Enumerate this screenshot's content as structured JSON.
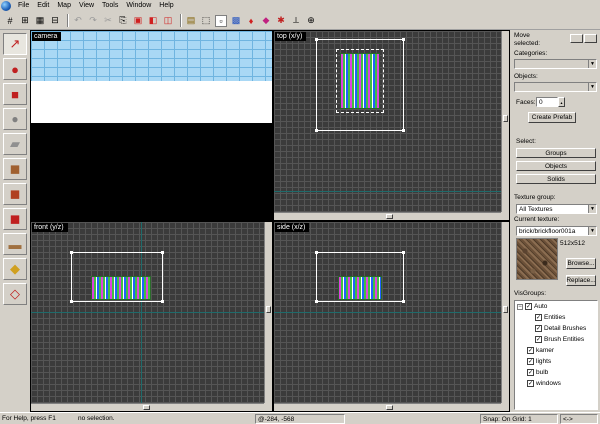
{
  "menu": [
    "File",
    "Edit",
    "Map",
    "View",
    "Tools",
    "Window",
    "Help"
  ],
  "toolbar_icons": [
    "grid-icon",
    "grid-smaller-icon",
    "grid-larger-icon",
    "texture-lock-icon",
    "undo-icon",
    "redo-icon",
    "carve-icon",
    "group-icon",
    "ungroup-icon",
    "hide-icon",
    "show-icon",
    "selection-box-icon",
    "select-handles-icon",
    "texture-app-icon",
    "run-map-icon",
    "entity-report-icon",
    "check-problems-icon",
    "cordon-icon",
    "decal-icon"
  ],
  "tools": [
    "pointer-icon",
    "magnify-icon",
    "camera-icon",
    "entity-icon",
    "block-icon",
    "texture-application-icon",
    "apply-texture-icon",
    "decal-icon",
    "overlay-icon",
    "clip-icon",
    "vertex-icon"
  ],
  "viewports": {
    "camera": "camera",
    "top": "top (x/y)",
    "front": "front (y/z)",
    "side": "side (x/z)"
  },
  "panel": {
    "move_selected": "Move selected:",
    "categories": "Categories:",
    "objects": "Objects:",
    "faces": "Faces:",
    "faces_value": "0",
    "create_prefab": "Create Prefab",
    "select": "Select:",
    "groups": "Groups",
    "objects_btn": "Objects",
    "solids": "Solids",
    "texture_group": "Texture group:",
    "texture_group_value": "All Textures",
    "current_texture": "Current texture:",
    "current_texture_value": "brick/brickfloor001a",
    "texture_size": "512x512",
    "browse": "Browse...",
    "replace": "Replace...",
    "visgroups": "VisGroups:",
    "visgroup_items": [
      {
        "label": "Auto",
        "level": 0,
        "expand": "−"
      },
      {
        "label": "Entities",
        "level": 1
      },
      {
        "label": "Detail Brushes",
        "level": 1
      },
      {
        "label": "Brush Entities",
        "level": 1
      },
      {
        "label": "kamer",
        "level": 0
      },
      {
        "label": "lights",
        "level": 0
      },
      {
        "label": "bulb",
        "level": 0
      },
      {
        "label": "windows",
        "level": 0
      }
    ]
  },
  "status": {
    "help": "For Help, press F1",
    "selection": "no selection.",
    "coords": "@-284, -568",
    "snap": "Snap: On Grid: 1",
    "arrows": "<->"
  }
}
